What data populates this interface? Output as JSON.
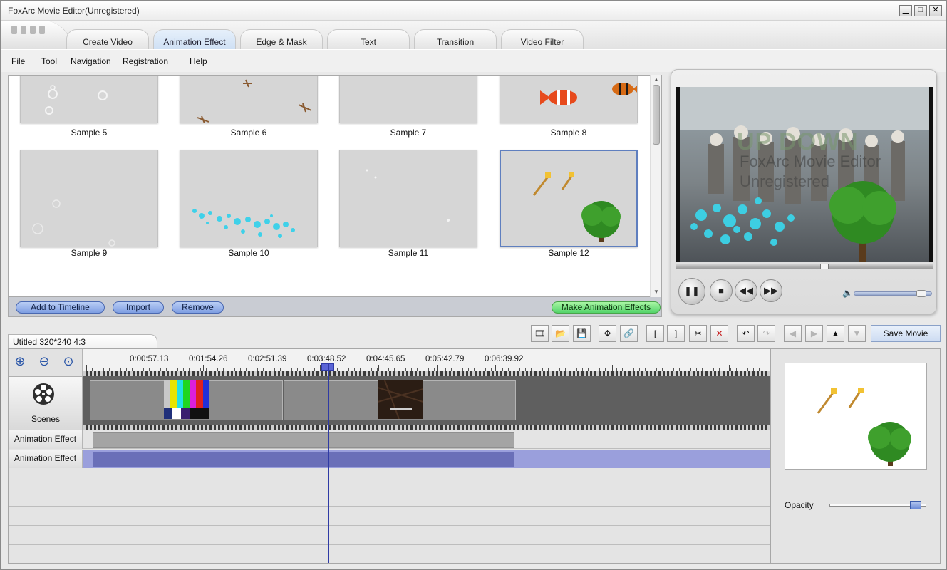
{
  "window": {
    "title": "FoxArc Movie Editor(Unregistered)",
    "controls": [
      "▁",
      "□",
      "✕"
    ]
  },
  "tabs": [
    {
      "label": "Create Video",
      "active": false
    },
    {
      "label": "Animation Effect",
      "active": true
    },
    {
      "label": "Edge & Mask",
      "active": false
    },
    {
      "label": "Text",
      "active": false
    },
    {
      "label": "Transition",
      "active": false
    },
    {
      "label": "Video Filter",
      "active": false
    }
  ],
  "menu": [
    "File",
    "Tool",
    "Navigation",
    "Registration",
    "Help"
  ],
  "library": {
    "items": [
      {
        "label": "Sample 5"
      },
      {
        "label": "Sample 6"
      },
      {
        "label": "Sample 7"
      },
      {
        "label": "Sample 8"
      },
      {
        "label": "Sample 9"
      },
      {
        "label": "Sample 10"
      },
      {
        "label": "Sample 11"
      },
      {
        "label": "Sample 12",
        "selected": true
      }
    ],
    "actions": {
      "add": "Add to Timeline",
      "import": "Import",
      "remove": "Remove",
      "make": "Make Animation Effects"
    }
  },
  "preview": {
    "watermark_logo": "UP DOWN",
    "watermark_line1": "FoxArc Movie Editor",
    "watermark_line2": "Unregistered",
    "progress": 0.58,
    "volume": 0.93
  },
  "project": {
    "tab_label": "Utitled 320*240 4:3",
    "save_label": "Save Movie"
  },
  "timeline": {
    "ruler_labels": [
      "0:00:57.13",
      "0:01:54.26",
      "0:02:51.39",
      "0:03:48.52",
      "0:04:45.65",
      "0:05:42.79",
      "0:06:39.92"
    ],
    "scenes_label": "Scenes",
    "tracks": [
      {
        "label": "Animation Effect"
      },
      {
        "label": "Animation Effect"
      }
    ]
  },
  "properties": {
    "opacity_label": "Opacity",
    "opacity": 0.95
  },
  "colors": {
    "accent_blue": "#7e9ee2",
    "accent_green": "#54d46b",
    "selection_purple": "#9a9fdc",
    "playhead": "#2f3aa5"
  }
}
